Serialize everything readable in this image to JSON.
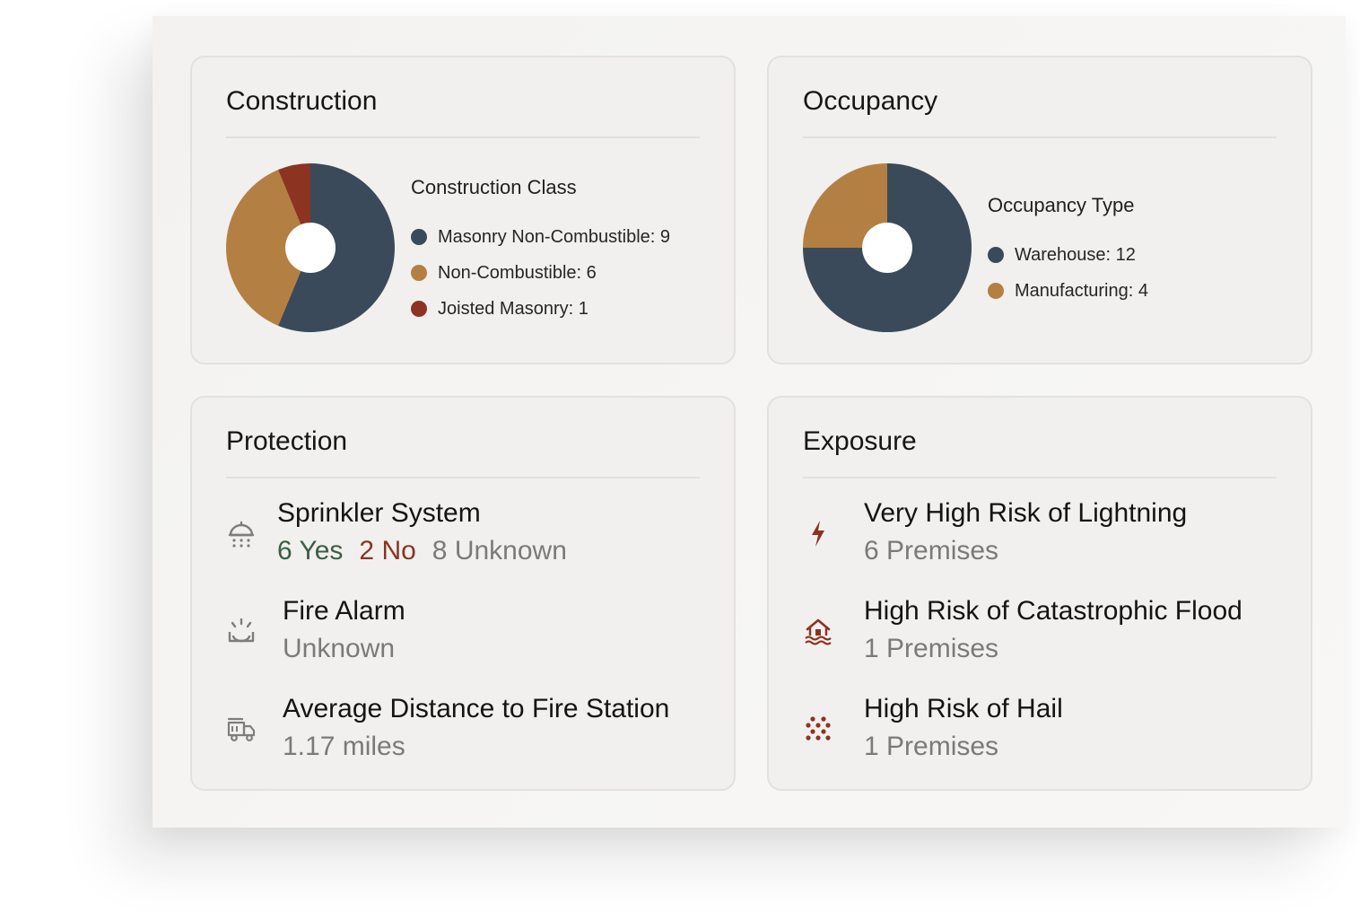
{
  "colors": {
    "slate": "#3b4a5a",
    "ochre": "#b47f42",
    "rust": "#8c3322",
    "yes": "#3a5f44",
    "no": "#8a3323",
    "muted": "#7b7a78"
  },
  "construction": {
    "title": "Construction",
    "legend_title": "Construction Class",
    "items": [
      {
        "label": "Masonry Non-Combustible: 9",
        "color": "#3b4a5a"
      },
      {
        "label": "Non-Combustible: 6",
        "color": "#b47f42"
      },
      {
        "label": "Joisted Masonry: 1",
        "color": "#8c3322"
      }
    ]
  },
  "occupancy": {
    "title": "Occupancy",
    "legend_title": "Occupancy Type",
    "items": [
      {
        "label": "Warehouse: 12",
        "color": "#3b4a5a"
      },
      {
        "label": "Manufacturing: 4",
        "color": "#b47f42"
      }
    ]
  },
  "chart_data": [
    {
      "type": "pie",
      "title": "Construction Class",
      "categories": [
        "Masonry Non-Combustible",
        "Non-Combustible",
        "Joisted Masonry"
      ],
      "values": [
        9,
        6,
        1
      ],
      "colors": [
        "#3b4a5a",
        "#b47f42",
        "#8c3322"
      ],
      "donut": true
    },
    {
      "type": "pie",
      "title": "Occupancy Type",
      "categories": [
        "Warehouse",
        "Manufacturing"
      ],
      "values": [
        12,
        4
      ],
      "colors": [
        "#3b4a5a",
        "#b47f42"
      ],
      "donut": true
    }
  ],
  "protection": {
    "title": "Protection",
    "sprinkler": {
      "label": "Sprinkler System",
      "yes": "6 Yes",
      "no": "2 No",
      "unknown": "8 Unknown",
      "icon": "sprinkler-icon"
    },
    "alarm": {
      "label": "Fire Alarm",
      "value": "Unknown",
      "icon": "fire-alarm-icon"
    },
    "distance": {
      "label": "Average Distance to Fire Station",
      "value": "1.17 miles",
      "icon": "fire-truck-icon"
    }
  },
  "exposure": {
    "title": "Exposure",
    "items": [
      {
        "label": "Very High Risk of Lightning",
        "value": "6 Premises",
        "icon": "lightning-icon"
      },
      {
        "label": "High Risk of Catastrophic Flood",
        "value": "1 Premises",
        "icon": "flood-icon"
      },
      {
        "label": "High Risk of Hail",
        "value": "1 Premises",
        "icon": "hail-icon"
      }
    ]
  }
}
